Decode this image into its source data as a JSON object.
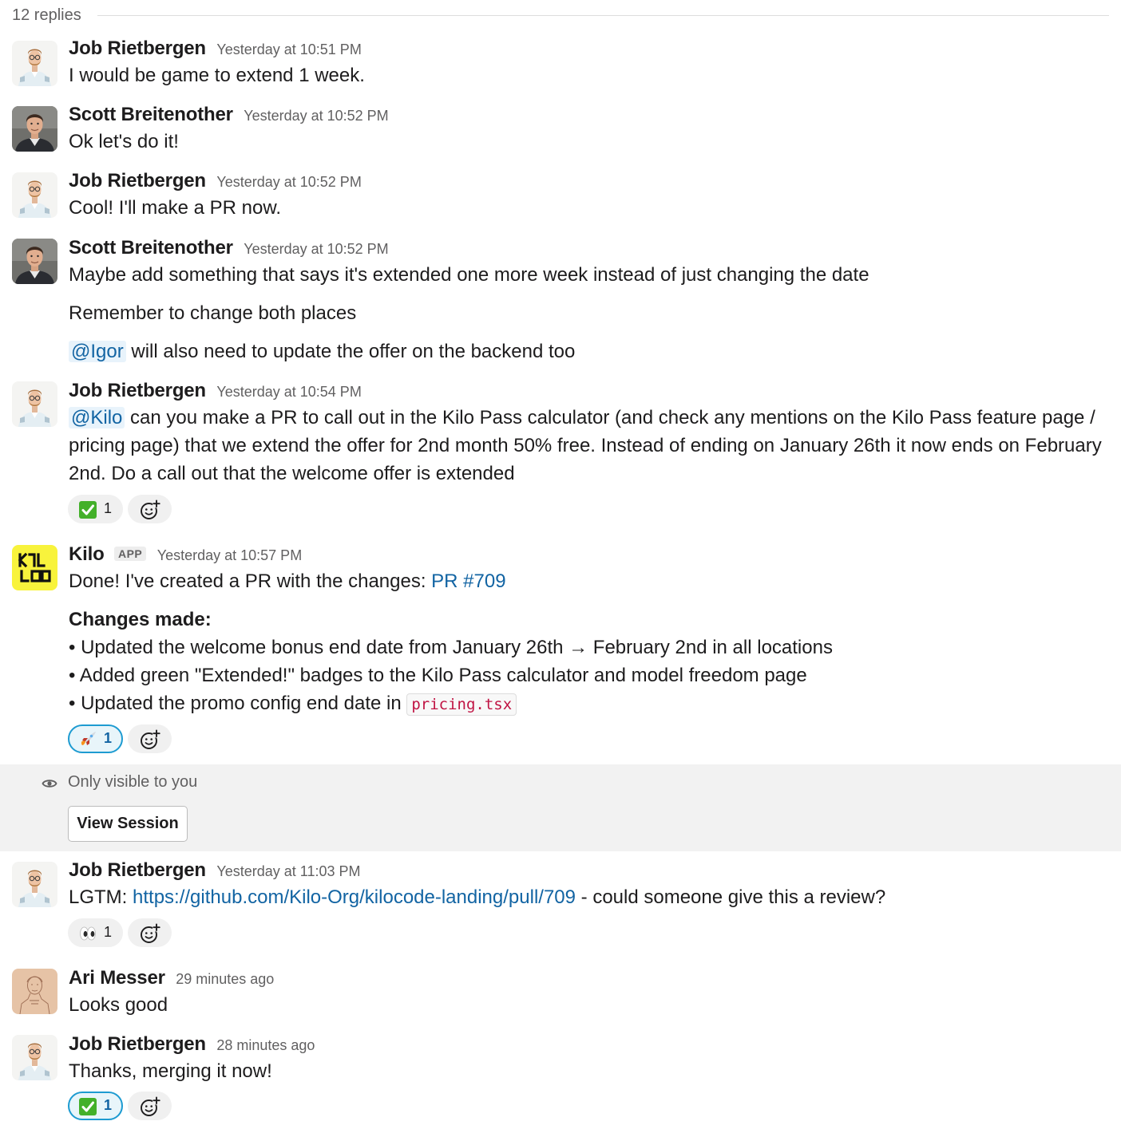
{
  "thread": {
    "replies_label": "12 replies"
  },
  "messages": [
    {
      "author": "Job Rietbergen",
      "time": "Yesterday at 10:51 PM",
      "lines": [
        "I would be game to extend 1 week."
      ]
    },
    {
      "author": "Scott Breitenother",
      "time": "Yesterday at 10:52 PM",
      "lines": [
        "Ok let's do it!"
      ]
    },
    {
      "author": "Job Rietbergen",
      "time": "Yesterday at 10:52 PM",
      "lines": [
        "Cool! I'll make a PR now."
      ]
    },
    {
      "author": "Scott Breitenother",
      "time": "Yesterday at 10:52 PM",
      "lines": [
        "Maybe add something that says it's extended one more week instead of just changing the date",
        "Remember to change both places"
      ],
      "mention": "@Igor",
      "mention_text": " will also need to update the offer on the backend too"
    },
    {
      "author": "Job Rietbergen",
      "time": "Yesterday at 10:54 PM",
      "mention": "@Kilo",
      "text_line1": " can you make a PR to call out in the Kilo Pass calculator (and check any mentions on the Kilo Pass feature page /",
      "text_line2": "pricing page) that we extend the offer for 2nd month 50% free. Instead of ending on January 26th it now ends on February",
      "text_line3": "2nd. Do a call out that the welcome offer is extended",
      "reaction": {
        "emoji": "white-check-mark",
        "count": "1"
      }
    },
    {
      "author": "Kilo",
      "badge": "APP",
      "time": "Yesterday at 10:57 PM",
      "intro": "Done! I've created a PR with the changes: ",
      "pr_link": "PR #709",
      "changes_heading": "Changes made:",
      "bullets": [
        "• Updated the welcome bonus end date from January 26th → February 2nd in all locations",
        "• Added green \"Extended!\" badges to the Kilo Pass calculator and model freedom page",
        "• Updated the promo config end date in "
      ],
      "code": "pricing.tsx",
      "reaction": {
        "emoji": "rocket",
        "count": "1"
      }
    },
    {
      "author": "Job Rietbergen",
      "time": "Yesterday at 11:03 PM",
      "prefix": "LGTM: ",
      "url": "https://github.com/Kilo-Org/kilocode-landing/pull/709",
      "suffix": " - could someone give this a review?",
      "reaction": {
        "emoji": "eyes",
        "count": "1"
      }
    },
    {
      "author": "Ari Messer",
      "time": "29 minutes ago",
      "lines": [
        "Looks good"
      ]
    },
    {
      "author": "Job Rietbergen",
      "time": "28 minutes ago",
      "lines": [
        "Thanks, merging it now!"
      ],
      "reaction": {
        "emoji": "white-check-mark",
        "count": "1"
      }
    }
  ],
  "ephemeral": {
    "visibility": "Only visible to you",
    "button": "View Session"
  },
  "colors": {
    "link": "#1264a3",
    "mention_bg": "#e8f3fb",
    "kilo_brand": "#f8f33c",
    "code_text": "#c01343",
    "active_reaction_border": "#1d9bd1"
  }
}
